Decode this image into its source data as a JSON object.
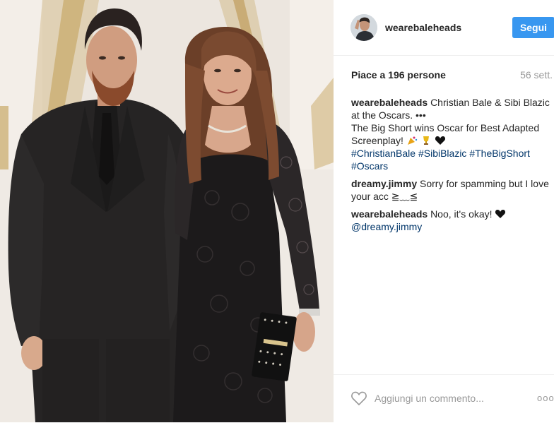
{
  "post": {
    "username": "wearebaleheads",
    "follow_label": "Segui",
    "likes_text": "Piace a 196 persone",
    "time_ago": "56 sett."
  },
  "comments": [
    {
      "user": "wearebaleheads",
      "line1": "Christian Bale & Sibi Blazic at the Oscars. •••",
      "line2": "The Big Short wins Oscar for Best Adapted Screenplay!",
      "tags": [
        "#ChristianBale",
        "#SibiBlazic",
        "#TheBigShort",
        "#Oscars"
      ]
    },
    {
      "user": "dreamy.jimmy",
      "text": "Sorry for spamming but I love your acc ≧﹏≦"
    },
    {
      "user": "wearebaleheads",
      "text": "Noo, it's okay!",
      "mention": "@dreamy.jimmy"
    }
  ],
  "comment_box": {
    "placeholder": "Aggiungi un commento..."
  },
  "more_label": "ooo",
  "icons": {
    "like": "heart-outline-icon",
    "more": "more-options-icon",
    "emoji1": "party-popper-emoji",
    "emoji2": "trophy-emoji",
    "emoji3": "black-heart-emoji"
  },
  "colors": {
    "follow_button": "#3897f0",
    "hashtag": "#003569",
    "muted": "#999999"
  }
}
